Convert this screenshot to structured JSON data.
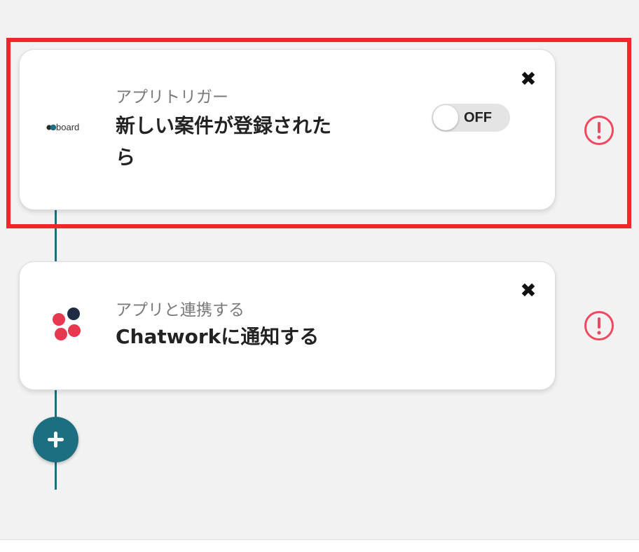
{
  "colors": {
    "flow_line": "#1c6e80",
    "highlight": "#f0262a",
    "warning": "#f0485f",
    "add_button": "#1c6e80"
  },
  "flow": {
    "steps": [
      {
        "subtitle": "アプリトリガー",
        "title": "新しい案件が登録されたら",
        "app_logo_text": "board",
        "app_icon": "board-logo",
        "toggle": {
          "state": "off",
          "label": "OFF"
        },
        "close_icon": "close-icon",
        "warning_icon": "warning-icon"
      },
      {
        "subtitle": "アプリと連携する",
        "title": "Chatworkに通知する",
        "app_icon": "chatwork-logo",
        "close_icon": "close-icon",
        "warning_icon": "warning-icon"
      }
    ],
    "add_button_icon": "plus-icon"
  }
}
